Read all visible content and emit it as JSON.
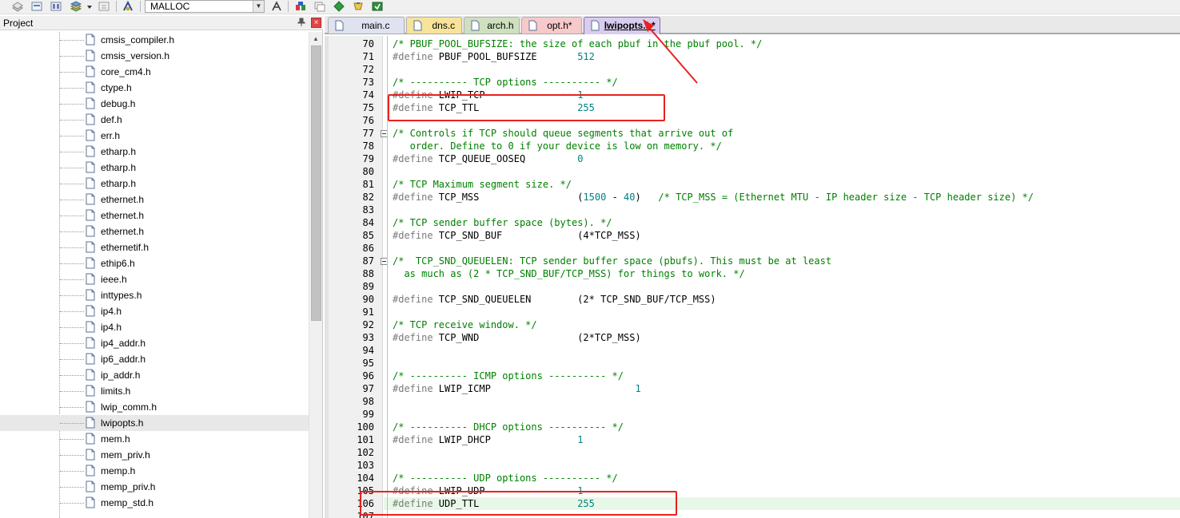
{
  "toolbar": {
    "target_value": "MALLOC",
    "icons": [
      "rebuild-icon",
      "build-icon",
      "batch-build-icon",
      "stack-icon",
      "dropdown-icon",
      "download-icon",
      "target-options-icon",
      "options-icon",
      "manage-icon",
      "diamond-icon",
      "pack-icon",
      "install-icon"
    ]
  },
  "project_panel": {
    "title": "Project",
    "pin_glyph": "⊥",
    "close_glyph": "×",
    "files": [
      "cmsis_compiler.h",
      "cmsis_version.h",
      "core_cm4.h",
      "ctype.h",
      "debug.h",
      "def.h",
      "err.h",
      "etharp.h",
      "etharp.h",
      "etharp.h",
      "ethernet.h",
      "ethernet.h",
      "ethernet.h",
      "ethernetif.h",
      "ethip6.h",
      "ieee.h",
      "inttypes.h",
      "ip4.h",
      "ip4.h",
      "ip4_addr.h",
      "ip6_addr.h",
      "ip_addr.h",
      "limits.h",
      "lwip_comm.h",
      "lwipopts.h",
      "mem.h",
      "mem_priv.h",
      "memp.h",
      "memp_priv.h",
      "memp_std.h"
    ],
    "selected_file": "lwipopts.h"
  },
  "tabs": [
    {
      "label": "main.c",
      "color": "#dfe3ef",
      "active": false
    },
    {
      "label": "dns.c",
      "color": "#f7e39a",
      "active": false
    },
    {
      "label": "arch.h",
      "color": "#cfe0bf",
      "active": false
    },
    {
      "label": "opt.h*",
      "color": "#f6c9cb",
      "active": false
    },
    {
      "label": "lwipopts.h*",
      "color": "#d9cdef",
      "active": true
    }
  ],
  "editor": {
    "current_line": "106",
    "lines": [
      {
        "n": "70",
        "parts": [
          {
            "t": "/* PBUF_POOL_BUFSIZE: the size of each pbuf in the pbuf pool. */",
            "c": "comment"
          }
        ]
      },
      {
        "n": "71",
        "parts": [
          {
            "t": "#define",
            "c": "pre"
          },
          {
            "t": " PBUF_POOL_BUFSIZE       ",
            "c": "name"
          },
          {
            "t": "512",
            "c": "num"
          }
        ]
      },
      {
        "n": "72",
        "parts": []
      },
      {
        "n": "73",
        "parts": [
          {
            "t": "/* ---------- TCP options ---------- */",
            "c": "comment"
          }
        ]
      },
      {
        "n": "74",
        "parts": [
          {
            "t": "#define",
            "c": "pre"
          },
          {
            "t": " LWIP_TCP                ",
            "c": "name"
          },
          {
            "t": "1",
            "c": "num"
          }
        ]
      },
      {
        "n": "75",
        "parts": [
          {
            "t": "#define",
            "c": "pre"
          },
          {
            "t": " TCP_TTL                 ",
            "c": "name"
          },
          {
            "t": "255",
            "c": "num"
          }
        ]
      },
      {
        "n": "76",
        "parts": []
      },
      {
        "n": "77",
        "fold": true,
        "parts": [
          {
            "t": "/* Controls if TCP should queue segments that arrive out of",
            "c": "comment"
          }
        ]
      },
      {
        "n": "78",
        "parts": [
          {
            "t": "   order. Define to 0 if your device is low on memory. */",
            "c": "comment"
          }
        ]
      },
      {
        "n": "79",
        "parts": [
          {
            "t": "#define",
            "c": "pre"
          },
          {
            "t": " TCP_QUEUE_OOSEQ         ",
            "c": "name"
          },
          {
            "t": "0",
            "c": "num"
          }
        ]
      },
      {
        "n": "80",
        "parts": []
      },
      {
        "n": "81",
        "parts": [
          {
            "t": "/* TCP Maximum segment size. */",
            "c": "comment"
          }
        ]
      },
      {
        "n": "82",
        "parts": [
          {
            "t": "#define",
            "c": "pre"
          },
          {
            "t": " TCP_MSS                 ",
            "c": "name"
          },
          {
            "t": "(",
            "c": "expr"
          },
          {
            "t": "1500",
            "c": "num"
          },
          {
            "t": " - ",
            "c": "expr"
          },
          {
            "t": "40",
            "c": "num"
          },
          {
            "t": ")   ",
            "c": "expr"
          },
          {
            "t": "/* TCP_MSS = (Ethernet MTU - IP header size - TCP header size) */",
            "c": "comment"
          }
        ]
      },
      {
        "n": "83",
        "parts": []
      },
      {
        "n": "84",
        "parts": [
          {
            "t": "/* TCP sender buffer space (bytes). */",
            "c": "comment"
          }
        ]
      },
      {
        "n": "85",
        "parts": [
          {
            "t": "#define",
            "c": "pre"
          },
          {
            "t": " TCP_SND_BUF             ",
            "c": "name"
          },
          {
            "t": "(4*TCP_MSS)",
            "c": "expr"
          }
        ]
      },
      {
        "n": "86",
        "parts": []
      },
      {
        "n": "87",
        "fold": true,
        "parts": [
          {
            "t": "/*  TCP_SND_QUEUELEN: TCP sender buffer space (pbufs). This must be at least",
            "c": "comment"
          }
        ]
      },
      {
        "n": "88",
        "parts": [
          {
            "t": "  as much as (2 * TCP_SND_BUF/TCP_MSS) for things to work. */",
            "c": "comment"
          }
        ]
      },
      {
        "n": "89",
        "parts": []
      },
      {
        "n": "90",
        "parts": [
          {
            "t": "#define",
            "c": "pre"
          },
          {
            "t": " TCP_SND_QUEUELEN        ",
            "c": "name"
          },
          {
            "t": "(2* TCP_SND_BUF/TCP_MSS)",
            "c": "expr"
          }
        ]
      },
      {
        "n": "91",
        "parts": []
      },
      {
        "n": "92",
        "parts": [
          {
            "t": "/* TCP receive window. */",
            "c": "comment"
          }
        ]
      },
      {
        "n": "93",
        "parts": [
          {
            "t": "#define",
            "c": "pre"
          },
          {
            "t": " TCP_WND                 ",
            "c": "name"
          },
          {
            "t": "(2*TCP_MSS)",
            "c": "expr"
          }
        ]
      },
      {
        "n": "94",
        "parts": []
      },
      {
        "n": "95",
        "parts": []
      },
      {
        "n": "96",
        "parts": [
          {
            "t": "/* ---------- ICMP options ---------- */",
            "c": "comment"
          }
        ]
      },
      {
        "n": "97",
        "parts": [
          {
            "t": "#define",
            "c": "pre"
          },
          {
            "t": " LWIP_ICMP                         ",
            "c": "name"
          },
          {
            "t": "1",
            "c": "num"
          }
        ]
      },
      {
        "n": "98",
        "parts": []
      },
      {
        "n": "99",
        "parts": []
      },
      {
        "n": "100",
        "parts": [
          {
            "t": "/* ---------- DHCP options ---------- */",
            "c": "comment"
          }
        ]
      },
      {
        "n": "101",
        "parts": [
          {
            "t": "#define",
            "c": "pre"
          },
          {
            "t": " LWIP_DHCP               ",
            "c": "name"
          },
          {
            "t": "1",
            "c": "num"
          }
        ]
      },
      {
        "n": "102",
        "parts": []
      },
      {
        "n": "103",
        "parts": []
      },
      {
        "n": "104",
        "parts": [
          {
            "t": "/* ---------- UDP options ---------- */",
            "c": "comment"
          }
        ]
      },
      {
        "n": "105",
        "parts": [
          {
            "t": "#define",
            "c": "pre"
          },
          {
            "t": " LWIP_UDP                ",
            "c": "name"
          },
          {
            "t": "1",
            "c": "num"
          }
        ]
      },
      {
        "n": "106",
        "parts": [
          {
            "t": "#define",
            "c": "pre"
          },
          {
            "t": " UDP_TTL                 ",
            "c": "name"
          },
          {
            "t": "255",
            "c": "num"
          }
        ]
      },
      {
        "n": "107",
        "parts": []
      }
    ]
  },
  "annotation_color": "#e8211c"
}
